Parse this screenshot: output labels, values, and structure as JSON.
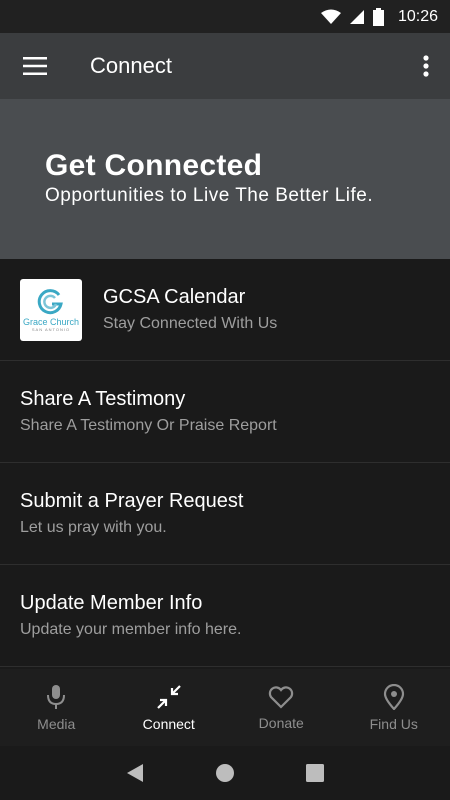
{
  "status_bar": {
    "time": "10:26"
  },
  "app_bar": {
    "title": "Connect"
  },
  "hero": {
    "title": "Get Connected",
    "subtitle": "Opportunities to Live The Better Life."
  },
  "list": [
    {
      "title": "GCSA Calendar",
      "subtitle": "Stay Connected With Us",
      "logo_name": "Grace Church",
      "logo_sub": "SAN ANTONIO"
    },
    {
      "title": "Share A Testimony",
      "subtitle": "Share A Testimony Or Praise Report"
    },
    {
      "title": "Submit a Prayer Request",
      "subtitle": "Let us pray with you."
    },
    {
      "title": "Update Member Info",
      "subtitle": "Update your member info here."
    }
  ],
  "bottom_nav": [
    {
      "label": "Media",
      "icon": "microphone-icon"
    },
    {
      "label": "Connect",
      "icon": "collapse-arrows-icon",
      "active": true
    },
    {
      "label": "Donate",
      "icon": "heart-icon"
    },
    {
      "label": "Find Us",
      "icon": "location-pin-icon"
    }
  ],
  "colors": {
    "app_bar": "#3b3d3f",
    "hero": "#4a4d50",
    "background": "#1a1a1a",
    "accent": "#3aa8c4"
  }
}
